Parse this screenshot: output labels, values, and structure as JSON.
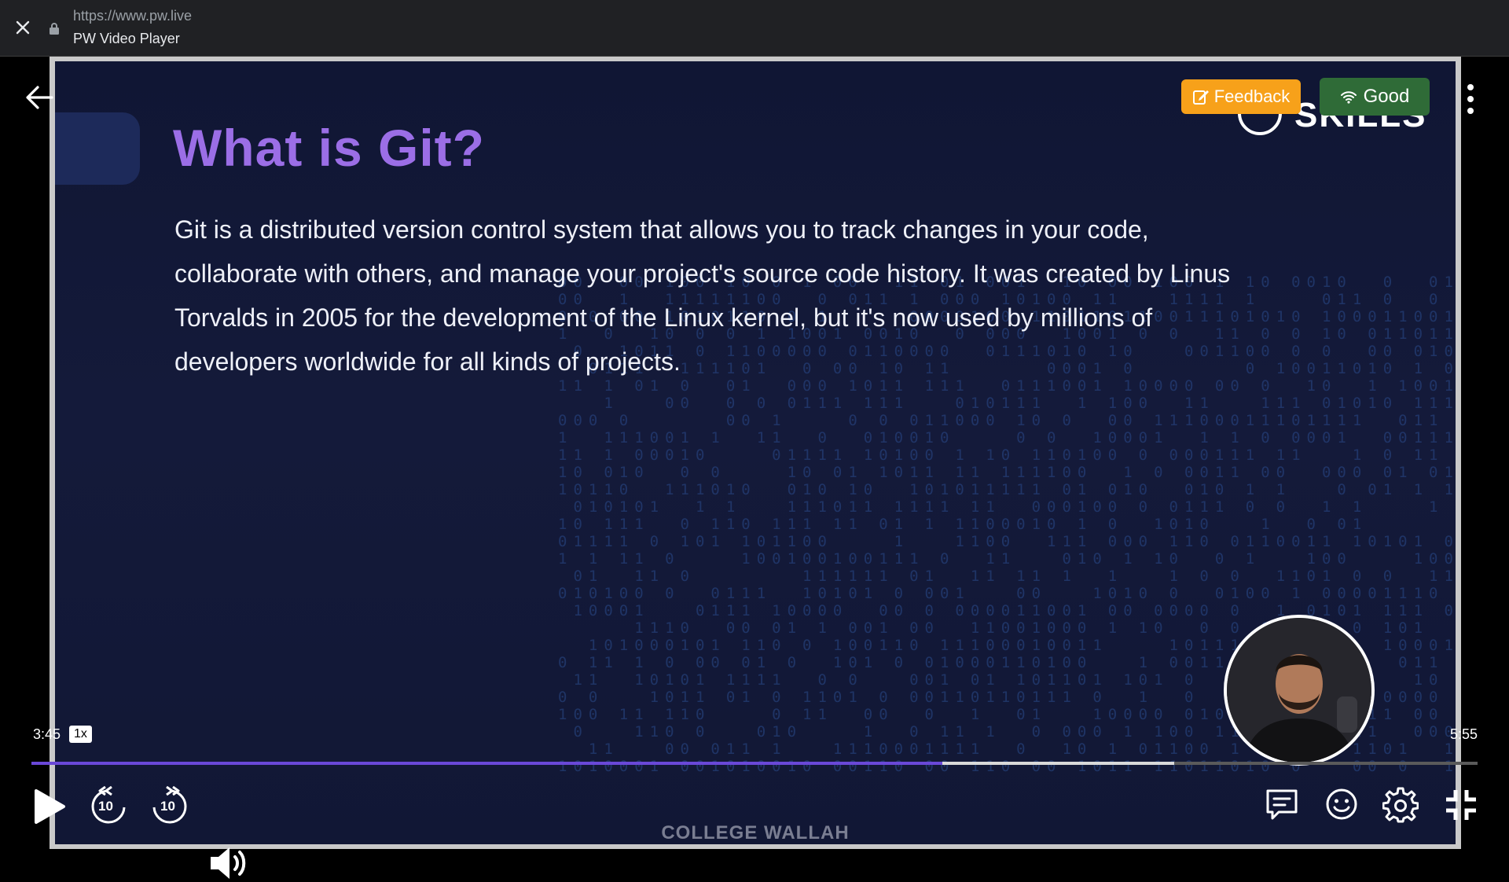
{
  "browser": {
    "url": "https://www.pw.live",
    "title": "PW Video Player"
  },
  "slide": {
    "heading": "What is Git?",
    "body": "Git is a distributed version control system that allows you to track changes in your code, collaborate with others, and manage your project's source code history. It was created by Linus Torvalds in 2005 for the development of the Linux kernel, but it's now used by millions of developers worldwide for all kinds of projects.",
    "brand_text": "SKILLS",
    "footer_brand": "COLLEGE  WALLAH"
  },
  "overlay": {
    "feedback_label": "Feedback",
    "network_label": "Good"
  },
  "player": {
    "time_current": "3:45",
    "time_total": "5:55",
    "speed": "1x",
    "progress_fraction": 0.63,
    "buffered_fraction": 0.79,
    "skip_seconds": "10"
  },
  "colors": {
    "accent_purple": "#9b6ee6",
    "progress": "#6a48d8",
    "feedback": "#f7a11a",
    "network_good": "#2f6b37"
  },
  "icons": [
    "close-icon",
    "lock-icon",
    "back-arrow-icon",
    "edit-icon",
    "wifi-icon",
    "kebab-menu-icon",
    "play-icon",
    "rewind-10-icon",
    "forward-10-icon",
    "volume-icon",
    "captions-icon",
    "emoji-icon",
    "settings-icon",
    "exit-fullscreen-icon"
  ]
}
